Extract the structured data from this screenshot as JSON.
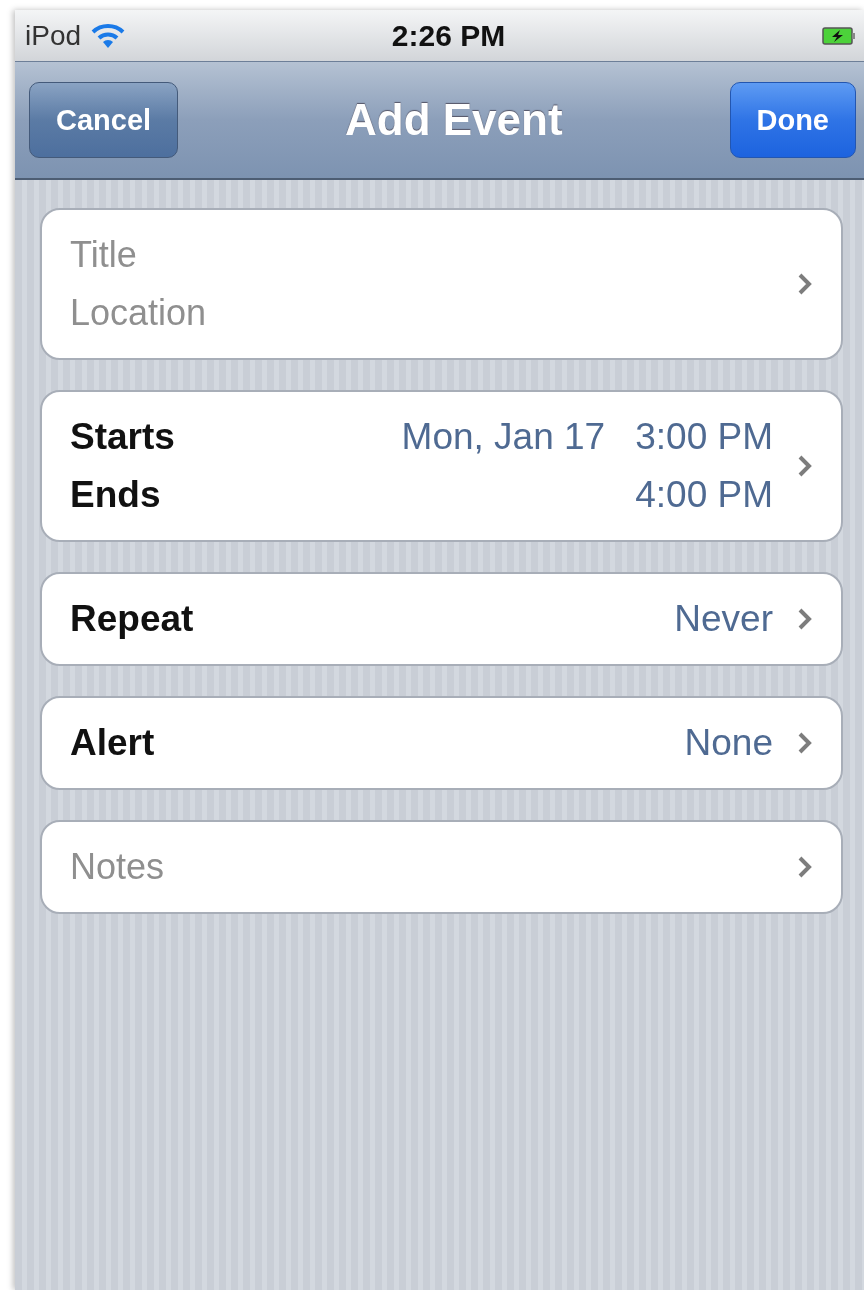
{
  "status_bar": {
    "carrier": "iPod",
    "time": "2:26 PM",
    "charging": true
  },
  "nav_bar": {
    "title": "Add Event",
    "left_button": "Cancel",
    "right_button": "Done"
  },
  "groups": [
    {
      "rows": [
        {
          "kind": "placeholder",
          "text": "Title"
        },
        {
          "kind": "placeholder",
          "text": "Location"
        }
      ]
    },
    {
      "rows": [
        {
          "kind": "field",
          "label": "Starts",
          "date": "Mon, Jan 17",
          "value": "3:00 PM"
        },
        {
          "kind": "field",
          "label": "Ends",
          "value": "4:00 PM"
        }
      ]
    },
    {
      "rows": [
        {
          "kind": "field",
          "label": "Repeat",
          "value": "Never"
        }
      ]
    },
    {
      "rows": [
        {
          "kind": "field",
          "label": "Alert",
          "value": "None"
        }
      ]
    },
    {
      "rows": [
        {
          "kind": "placeholder",
          "text": "Notes"
        }
      ]
    }
  ]
}
